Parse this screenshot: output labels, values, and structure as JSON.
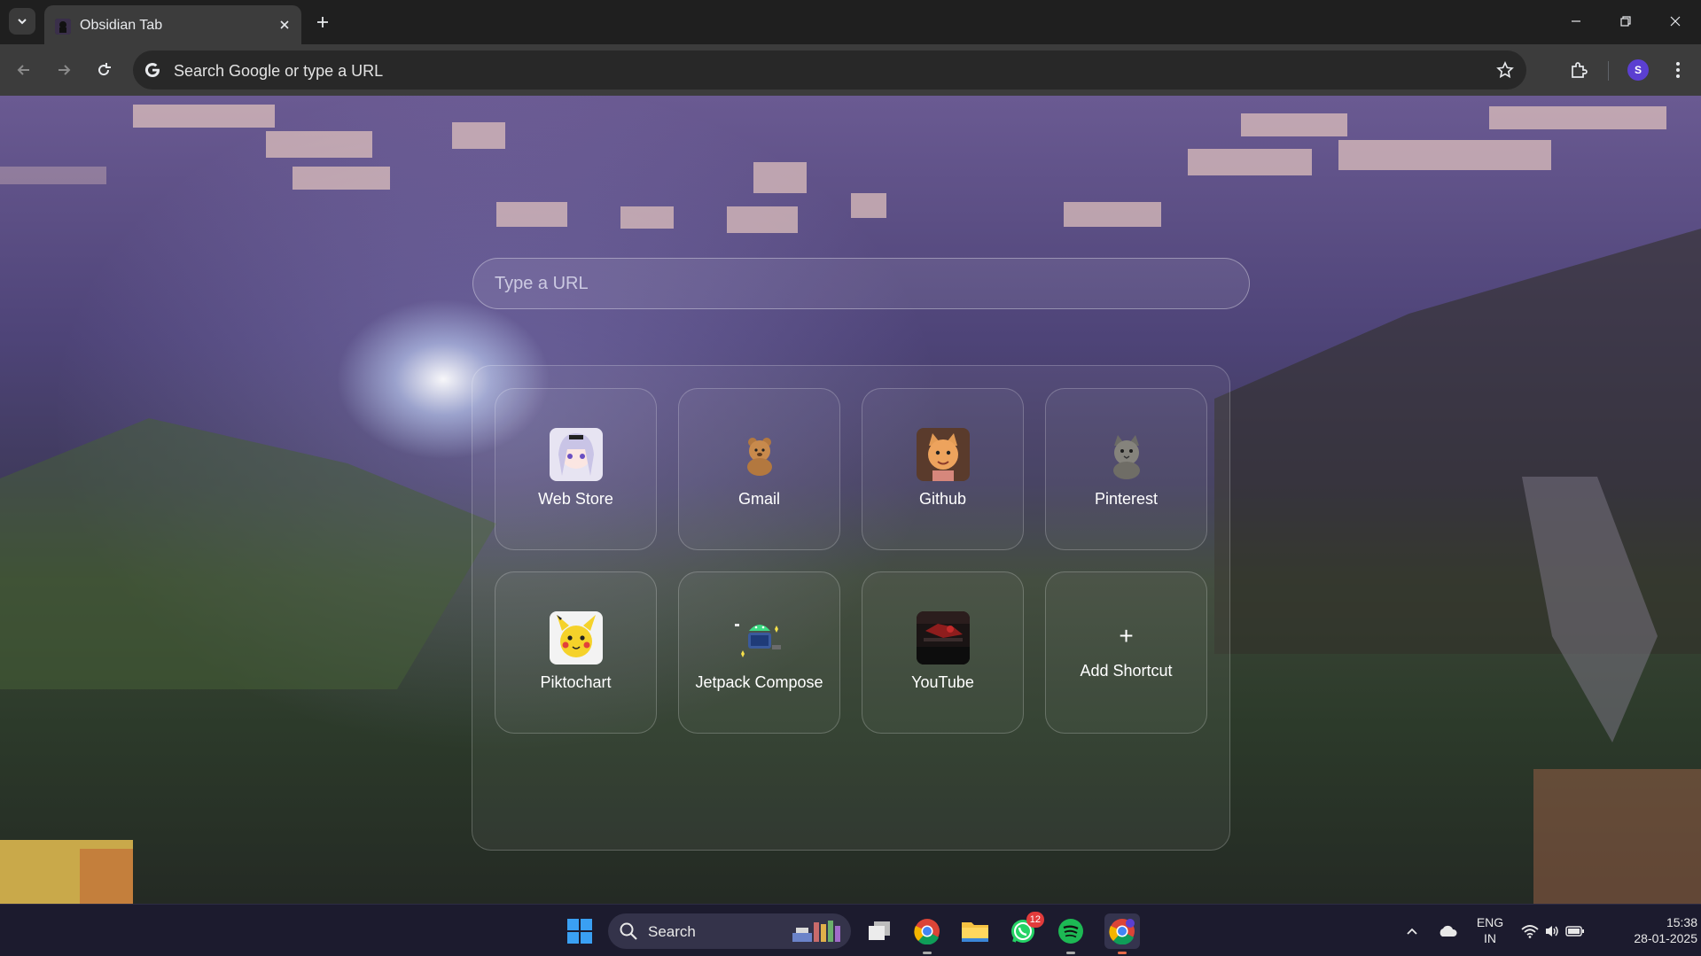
{
  "browser": {
    "tab": {
      "title": "Obsidian Tab",
      "close_symbol": "✕"
    },
    "new_tab_symbol": "+",
    "omnibox": {
      "text": "Search Google or type a URL"
    },
    "profile_initial": "S"
  },
  "page": {
    "url_input": {
      "placeholder": "Type a URL"
    },
    "shortcuts": [
      {
        "label": "Web Store",
        "icon": "anime-girl-icon"
      },
      {
        "label": "Gmail",
        "icon": "bear-icon"
      },
      {
        "label": "Github",
        "icon": "cat-icon"
      },
      {
        "label": "Pinterest",
        "icon": "cat-icon"
      },
      {
        "label": "Piktochart",
        "icon": "pikachu-icon"
      },
      {
        "label": "Jetpack Compose",
        "icon": "android-icon"
      },
      {
        "label": "YouTube",
        "icon": "video-thumbnail-icon"
      }
    ],
    "add_shortcut": {
      "symbol": "+",
      "label": "Add Shortcut"
    }
  },
  "taskbar": {
    "search_text": "Search",
    "whatsapp_badge": "12",
    "lang": {
      "line1": "ENG",
      "line2": "IN"
    },
    "clock": {
      "time": "15:38",
      "date": "28-01-2025"
    }
  },
  "colors": {
    "accent": "#5b3fd1",
    "taskbar": "#1c1b2e",
    "toolbar": "#3c3c3c"
  }
}
